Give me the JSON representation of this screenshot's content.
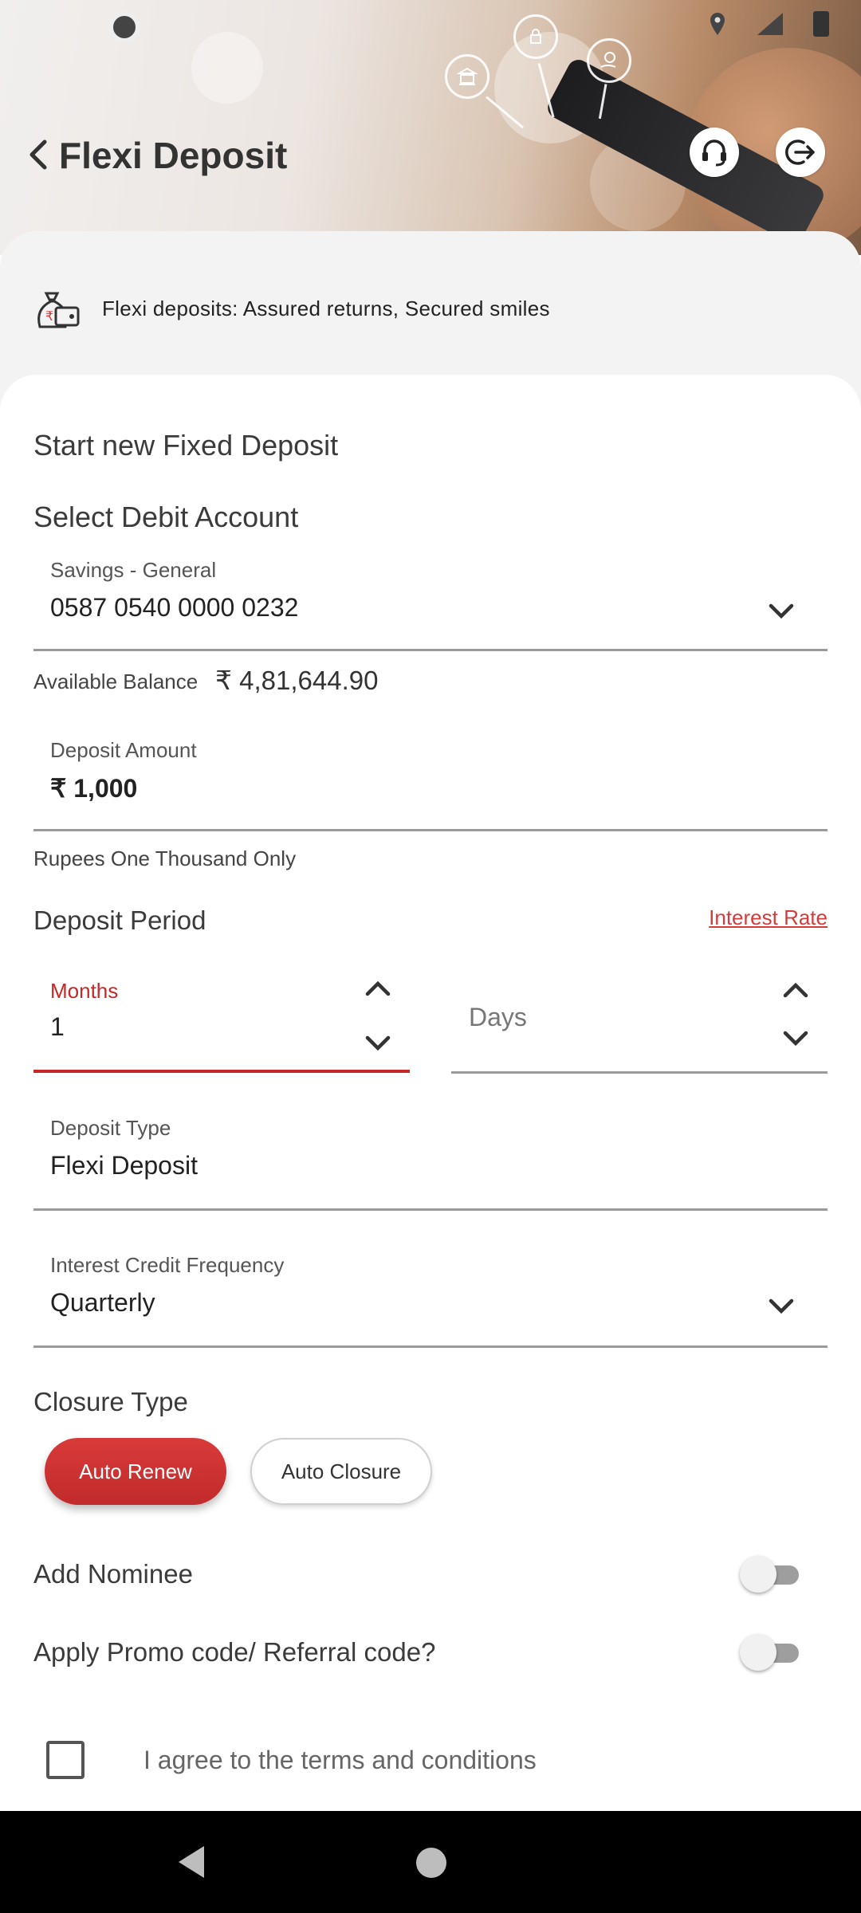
{
  "header": {
    "title": "Flexi Deposit",
    "back_icon": "chevron-left-icon",
    "support_icon": "headset-icon",
    "logout_icon": "logout-icon"
  },
  "banner": {
    "text": "Flexi deposits: Assured returns, Secured smiles",
    "icon": "money-wallet-icon"
  },
  "form": {
    "section_title": "Start new Fixed Deposit",
    "debit_account": {
      "heading": "Select Debit Account",
      "label": "Savings - General",
      "value": "0587 0540 0000 0232"
    },
    "available_balance": {
      "label": "Available Balance",
      "value": "₹ 4,81,644.90"
    },
    "deposit_amount": {
      "label": "Deposit Amount",
      "value": "₹ 1,000",
      "words": "Rupees One Thousand Only"
    },
    "deposit_period": {
      "heading": "Deposit Period",
      "interest_rate_link": "Interest Rate",
      "months_label": "Months",
      "months_value": "1",
      "days_placeholder": "Days"
    },
    "deposit_type": {
      "label": "Deposit Type",
      "value": "Flexi Deposit"
    },
    "interest_credit_frequency": {
      "label": "Interest Credit Frequency",
      "value": "Quarterly"
    },
    "closure_type": {
      "heading": "Closure Type",
      "options": [
        "Auto Renew",
        "Auto Closure"
      ],
      "selected": "Auto Renew"
    },
    "add_nominee": {
      "label": "Add Nominee",
      "enabled": false
    },
    "promo_code": {
      "label": "Apply Promo code/ Referral code?",
      "enabled": false
    },
    "terms": {
      "label": "I agree to the terms and conditions",
      "checked": false
    }
  },
  "colors": {
    "accent": "#d63b3b",
    "active_underline": "#c62828",
    "text_dark": "#333333"
  }
}
